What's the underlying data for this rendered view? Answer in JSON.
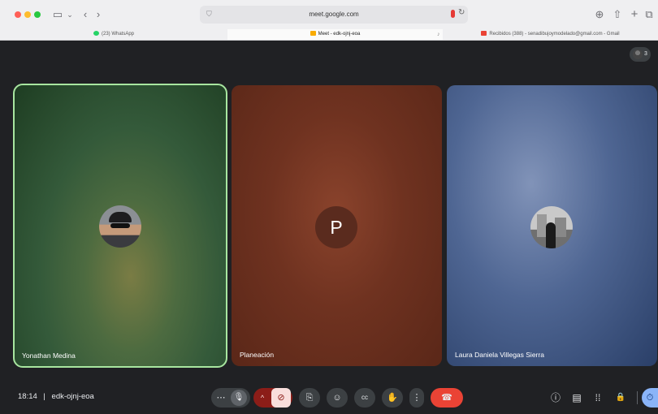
{
  "browser": {
    "url": "meet.google.com",
    "tabs": [
      {
        "label": "(23) WhatsApp",
        "favicon_color": "#25d366"
      },
      {
        "label": "Meet - edk-ojnj-eoa",
        "favicon_color": "#f9ab00"
      },
      {
        "label": "Recibidos (388) - senadibujoymodelado@gmail.com - Gmail",
        "favicon_color": "#ea4335"
      }
    ]
  },
  "meet": {
    "participant_count": "3",
    "tiles": [
      {
        "name": "Yonathan Medina",
        "avatar_type": "photo"
      },
      {
        "name": "Planeación",
        "initial": "P"
      },
      {
        "name": "Laura Daniela Villegas Sierra",
        "avatar_type": "photo"
      }
    ],
    "footer": {
      "time": "18:14",
      "separator": "|",
      "code": "edk-ojnj-eoa"
    },
    "controls": [
      {
        "name": "more-audio-options",
        "icon": "more-horiz-icon",
        "glyph": "⋯"
      },
      {
        "name": "mic",
        "icon": "mic-icon",
        "glyph": "🎙"
      },
      {
        "name": "camera-options",
        "icon": "chevron-up-icon",
        "glyph": "^"
      },
      {
        "name": "camera-off",
        "icon": "videocam-off-icon",
        "glyph": "⊘"
      },
      {
        "name": "present",
        "icon": "present-screen-icon",
        "glyph": "⎘"
      },
      {
        "name": "reactions",
        "icon": "emoji-icon",
        "glyph": "☺"
      },
      {
        "name": "captions",
        "icon": "captions-icon",
        "glyph": "cc"
      },
      {
        "name": "raise-hand",
        "icon": "hand-icon",
        "glyph": "✋"
      },
      {
        "name": "more-options",
        "icon": "more-vert-icon",
        "glyph": "⋮"
      },
      {
        "name": "leave-call",
        "icon": "call-end-icon",
        "glyph": "☎"
      }
    ],
    "right_controls": [
      {
        "name": "meeting-details",
        "icon": "info-icon",
        "glyph": "ⓘ"
      },
      {
        "name": "chat",
        "icon": "chat-icon",
        "glyph": "▤"
      },
      {
        "name": "activities",
        "icon": "apps-icon",
        "glyph": "⁞⁞"
      },
      {
        "name": "host-controls",
        "icon": "lock-person-icon",
        "glyph": "🔒"
      },
      {
        "name": "timer",
        "icon": "timer-icon",
        "glyph": "⏱"
      }
    ],
    "colors": {
      "background": "#202124",
      "active_speaker_border": "#a8e6a0",
      "leave_red": "#ea4335",
      "camera_off_bg": "#f9dedc"
    }
  }
}
